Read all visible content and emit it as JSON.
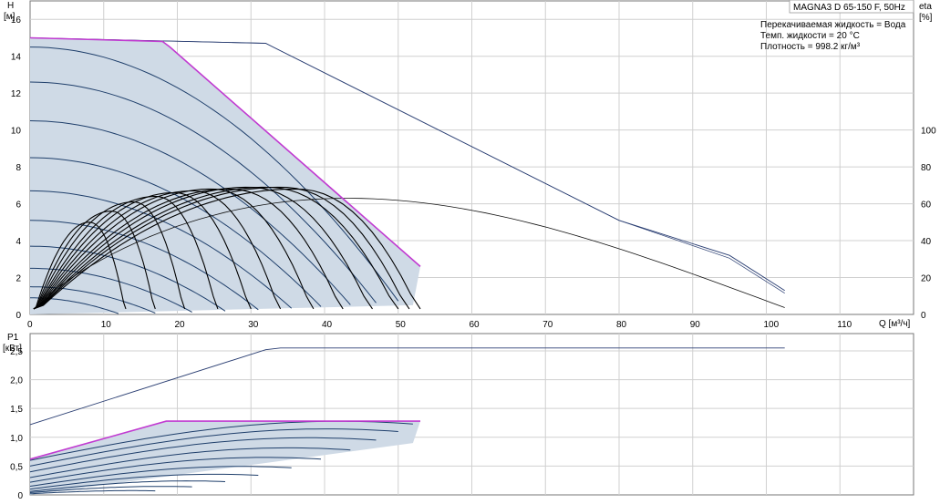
{
  "title": "MAGNA3 D 65-150 F, 50Hz",
  "info": [
    "Перекачиваемая жидкость = Вода",
    "Темп. жидкости = 20 °C",
    "Плотность = 998.2 кг/м³"
  ],
  "chart_data": [
    {
      "type": "line",
      "xlabel": "Q [м³/ч]",
      "ylabel": [
        "H",
        "[м]"
      ],
      "ylabel_right": [
        "eta",
        "[%]"
      ],
      "xlim": [
        0,
        120
      ],
      "ylim": [
        0,
        17
      ],
      "ylim_right": [
        0,
        170
      ],
      "xticks": [
        0,
        10,
        20,
        30,
        40,
        50,
        60,
        70,
        80,
        90,
        100,
        110
      ],
      "yticks": [
        0,
        2,
        4,
        6,
        8,
        10,
        12,
        14,
        16
      ],
      "yticks_right": [
        0,
        20,
        40,
        60,
        80,
        100
      ],
      "grid": true,
      "envelope_max": [
        [
          0,
          15.0
        ],
        [
          18,
          14.8
        ],
        [
          19,
          14.5
        ],
        [
          53,
          2.6
        ]
      ],
      "twin_pump_curve": [
        [
          0,
          15.0
        ],
        [
          32,
          14.7
        ],
        [
          33,
          14.5
        ],
        [
          80,
          5.1
        ],
        [
          95,
          3.2
        ],
        [
          102.5,
          1.3
        ]
      ],
      "eta_twin": [
        [
          0,
          0
        ],
        [
          20,
          35
        ],
        [
          35,
          50
        ],
        [
          55,
          63
        ],
        [
          70,
          60
        ],
        [
          85,
          47
        ],
        [
          100,
          20
        ]
      ],
      "speed_curves": [
        {
          "h0": 14.5,
          "qmax": 50
        },
        {
          "h0": 12.6,
          "qmax": 47
        },
        {
          "h0": 10.5,
          "qmax": 43.5
        },
        {
          "h0": 8.5,
          "qmax": 39.5
        },
        {
          "h0": 6.7,
          "qmax": 35.5
        },
        {
          "h0": 5.1,
          "qmax": 31
        },
        {
          "h0": 3.7,
          "qmax": 26.5
        },
        {
          "h0": 2.5,
          "qmax": 22
        },
        {
          "h0": 1.5,
          "qmax": 17
        },
        {
          "h0": 0.9,
          "qmax": 12
        }
      ],
      "eta_lines": [
        {
          "qpk": 8,
          "hpk": 5.0,
          "qend": 13
        },
        {
          "qpk": 11,
          "hpk": 5.6,
          "qend": 17
        },
        {
          "qpk": 14,
          "hpk": 6.1,
          "qend": 21
        },
        {
          "qpk": 17,
          "hpk": 6.4,
          "qend": 25.5
        },
        {
          "qpk": 19.5,
          "hpk": 6.6,
          "qend": 30
        },
        {
          "qpk": 22,
          "hpk": 6.7,
          "qend": 34
        },
        {
          "qpk": 24.5,
          "hpk": 6.8,
          "qend": 38.5
        },
        {
          "qpk": 27,
          "hpk": 6.8,
          "qend": 42.5
        },
        {
          "qpk": 29.5,
          "hpk": 6.9,
          "qend": 46.5
        },
        {
          "qpk": 32,
          "hpk": 6.9,
          "qend": 50
        },
        {
          "qpk": 34,
          "hpk": 6.9,
          "qend": 51.5
        },
        {
          "qpk": 36,
          "hpk": 6.8,
          "qend": 53
        }
      ]
    },
    {
      "type": "line",
      "xlabel": "",
      "ylabel": [
        "P1",
        "[кВт]"
      ],
      "xlim": [
        0,
        120
      ],
      "ylim": [
        0,
        2.8
      ],
      "yticks": [
        0,
        0.5,
        1.0,
        1.5,
        2.0,
        2.5
      ],
      "ytick_labels": [
        "0",
        "0,5",
        "1,0",
        "1,5",
        "2,0",
        "2,5"
      ],
      "grid": true,
      "twin_power": [
        [
          0,
          1.22
        ],
        [
          32,
          2.52
        ],
        [
          34,
          2.55
        ],
        [
          102.5,
          2.55
        ]
      ],
      "envelope_max": [
        [
          0,
          0.62
        ],
        [
          18.5,
          1.28
        ],
        [
          53,
          1.28
        ]
      ],
      "region_bottom": [
        [
          0,
          0
        ],
        [
          52,
          0.9
        ],
        [
          53,
          1.28
        ]
      ],
      "speed_power": [
        {
          "p0": 0.6,
          "pmax": 1.23,
          "qmax": 52
        },
        {
          "p0": 0.5,
          "pmax": 1.1,
          "qmax": 50
        },
        {
          "p0": 0.4,
          "pmax": 0.95,
          "qmax": 47
        },
        {
          "p0": 0.3,
          "pmax": 0.78,
          "qmax": 43.5
        },
        {
          "p0": 0.22,
          "pmax": 0.62,
          "qmax": 39.5
        },
        {
          "p0": 0.15,
          "pmax": 0.47,
          "qmax": 35.5
        },
        {
          "p0": 0.1,
          "pmax": 0.34,
          "qmax": 31
        },
        {
          "p0": 0.06,
          "pmax": 0.23,
          "qmax": 26.5
        },
        {
          "p0": 0.04,
          "pmax": 0.14,
          "qmax": 22
        },
        {
          "p0": 0.02,
          "pmax": 0.07,
          "qmax": 17
        }
      ]
    }
  ]
}
